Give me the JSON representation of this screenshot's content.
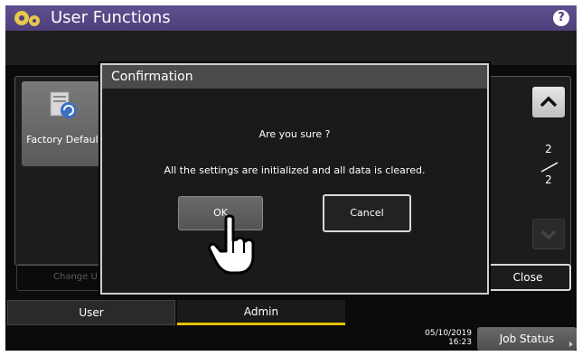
{
  "header": {
    "title": "User Functions",
    "help_icon": "question-icon",
    "help_label": "?"
  },
  "background": {
    "tile": {
      "label": "Factory Default",
      "icon": "factory-default-icon"
    },
    "page_indicator": {
      "current": "2",
      "total": "2"
    },
    "change_button_label": "Change U",
    "close_button_label": "Close"
  },
  "tabs": [
    {
      "label": "User"
    },
    {
      "label": "Admin"
    }
  ],
  "status_bar": {
    "date": "05/10/2019",
    "time": "16:23",
    "job_status_label": "Job Status"
  },
  "dialog": {
    "title": "Confirmation",
    "message": "Are you sure ?",
    "detail": "All the settings are initialized and all data is cleared.",
    "ok_label": "OK",
    "cancel_label": "Cancel"
  },
  "colors": {
    "title_bar": "#4e3f7c",
    "active_tab_underline": "#e6c200"
  }
}
